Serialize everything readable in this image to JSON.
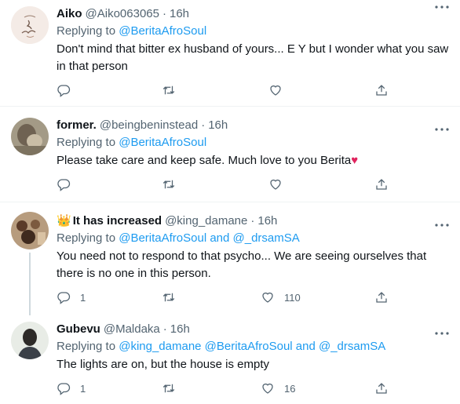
{
  "tweets": [
    {
      "name": "Aiko",
      "handle": "@Aiko063065",
      "time": "16h",
      "replying_label": "Replying to",
      "mentions": "@BeritaAfroSoul",
      "text": "Don't mind that bitter ex husband of yours... E Y but I wonder what you saw in that person",
      "reply_count": "",
      "retweet_count": "",
      "like_count": ""
    },
    {
      "name": "former.",
      "handle": "@beingbeninstead",
      "time": "16h",
      "replying_label": "Replying to",
      "mentions": "@BeritaAfroSoul",
      "text": "Please take care and keep safe. Much love to you Berita",
      "text_emoji": "♥",
      "reply_count": "",
      "retweet_count": "",
      "like_count": ""
    },
    {
      "name_emoji": "👑",
      "name": "It has increased",
      "handle": "@king_damane",
      "time": "16h",
      "replying_label": "Replying to",
      "mentions": "@BeritaAfroSoul and @_drsamSA",
      "text": "You need not to respond to that psycho... We are seeing ourselves that there is no one in this person.",
      "reply_count": "1",
      "retweet_count": "",
      "like_count": "110"
    },
    {
      "name": "Gubevu",
      "handle": "@Maldaka",
      "time": "16h",
      "replying_label": "Replying to",
      "mentions": "@king_damane @BeritaAfroSoul and @_drsamSA",
      "text": "The lights are on, but the house is empty",
      "reply_count": "1",
      "retweet_count": "",
      "like_count": "16"
    }
  ],
  "separator": "·",
  "icons": {
    "reply": "reply-icon",
    "retweet": "retweet-icon",
    "like": "like-icon",
    "share": "share-icon",
    "more": "more-options-icon"
  },
  "colors": {
    "accent": "#1d9bf0",
    "muted": "#536471",
    "text": "#0f1419",
    "heart": "#e0245e"
  }
}
